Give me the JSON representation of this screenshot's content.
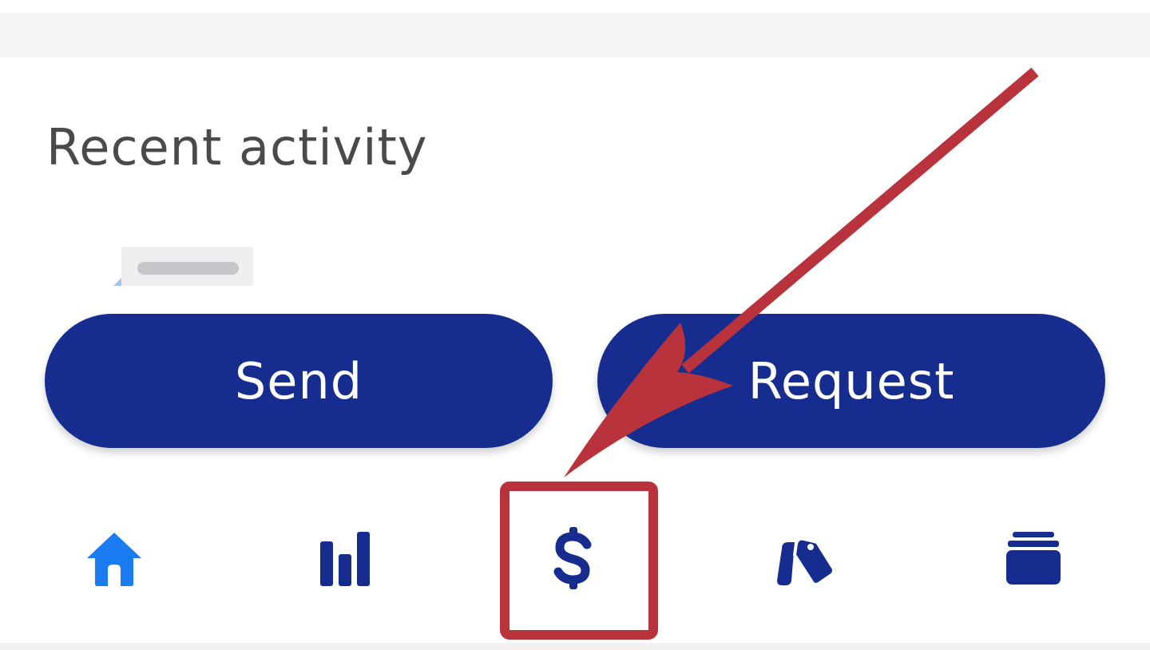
{
  "section": {
    "title": "Recent activity"
  },
  "actions": {
    "send_label": "Send",
    "request_label": "Request"
  },
  "nav": {
    "items": [
      {
        "icon": "home-icon",
        "active": true
      },
      {
        "icon": "bar-chart-icon",
        "active": false
      },
      {
        "icon": "dollar-icon",
        "active": false,
        "highlighted": true
      },
      {
        "icon": "price-tags-icon",
        "active": false
      },
      {
        "icon": "wallet-cards-icon",
        "active": false
      }
    ]
  },
  "colors": {
    "brand": "#162d8f",
    "active_icon": "#1a7cf0",
    "annotation": "#b9333c",
    "title_text": "#4a4a4c"
  }
}
